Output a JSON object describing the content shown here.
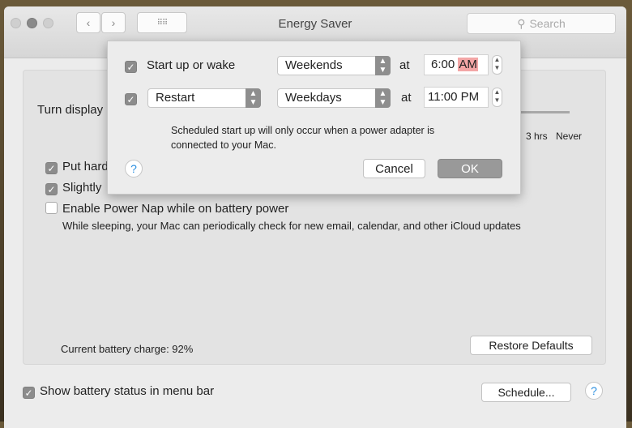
{
  "window": {
    "title": "Energy Saver",
    "search_placeholder": "Search"
  },
  "main": {
    "turn_display_label": "Turn display",
    "slider_ticks": [
      "3 hrs",
      "Never"
    ],
    "put_hard_label": "Put hard",
    "slightly_label": "Slightly",
    "power_nap_label": "Enable Power Nap while on battery power",
    "power_nap_desc": "While sleeping, your Mac can periodically check for new email, calendar, and other iCloud updates",
    "battery_charge": "Current battery charge: 92%",
    "restore_defaults": "Restore Defaults",
    "show_battery_status": "Show battery status in menu bar",
    "schedule_button": "Schedule..."
  },
  "sheet": {
    "row1": {
      "label": "Start up or wake",
      "day": "Weekends",
      "at": "at",
      "time": "6:00",
      "ampm": "AM"
    },
    "row2": {
      "action": "Restart",
      "day": "Weekdays",
      "at": "at",
      "time": "11:00 PM"
    },
    "note_line1": "Scheduled start up will only occur when a power adapter is",
    "note_line2": "connected to your Mac.",
    "cancel": "Cancel",
    "ok": "OK"
  },
  "colors": {
    "highlight": "#f3a6a6",
    "help": "#2a8fe0"
  }
}
